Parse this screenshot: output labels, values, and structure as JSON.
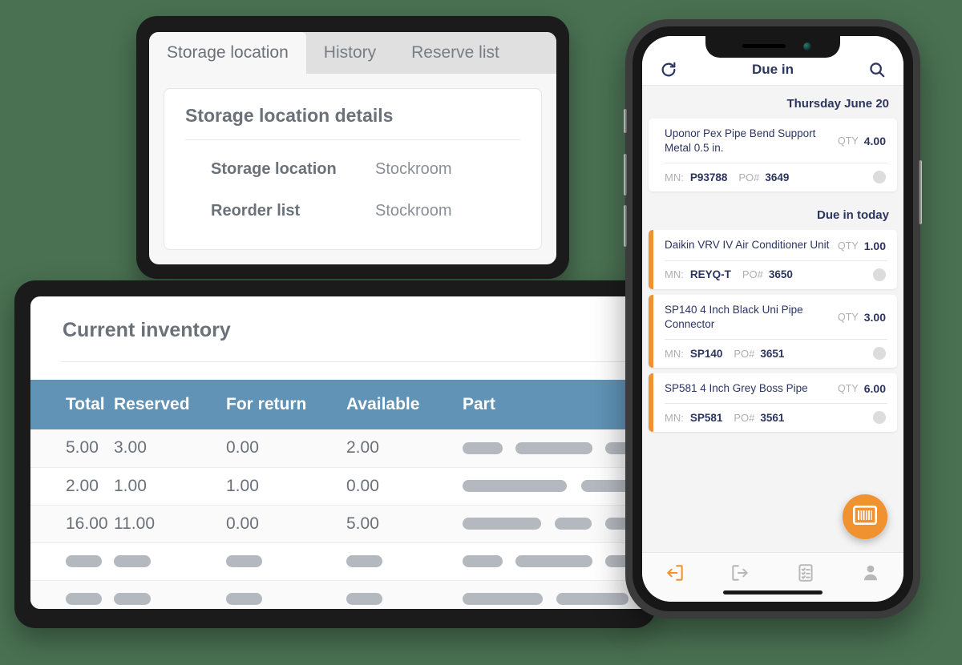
{
  "storage_card": {
    "tabs": [
      {
        "label": "Storage location",
        "active": true
      },
      {
        "label": "History",
        "active": false
      },
      {
        "label": "Reserve list",
        "active": false
      }
    ],
    "panel_title": "Storage location details",
    "fields": [
      {
        "label": "Storage location",
        "value": "Stockroom"
      },
      {
        "label": "Reorder list",
        "value": "Stockroom"
      }
    ]
  },
  "inventory_card": {
    "title": "Current inventory",
    "header_color": "#6093b5",
    "columns": [
      "Total",
      "Reserved",
      "For return",
      "Available",
      "Part"
    ],
    "rows": [
      {
        "total": "5.00",
        "reserved": "3.00",
        "for_return": "0.00",
        "available": "2.00",
        "part_placeholder": true
      },
      {
        "total": "2.00",
        "reserved": "1.00",
        "for_return": "1.00",
        "available": "0.00",
        "part_placeholder": true
      },
      {
        "total": "16.00",
        "reserved": "11.00",
        "for_return": "0.00",
        "available": "5.00",
        "part_placeholder": true
      },
      {
        "total": "",
        "reserved": "",
        "for_return": "",
        "available": "",
        "part_placeholder": true
      },
      {
        "total": "",
        "reserved": "",
        "for_return": "",
        "available": "",
        "part_placeholder": true
      }
    ]
  },
  "phone": {
    "accent_color": "#f0922f",
    "text_color": "#2c3560",
    "header": {
      "title": "Due in",
      "refresh_icon": "refresh-icon",
      "search_icon": "search-icon"
    },
    "sections": [
      {
        "heading": "Thursday June 20",
        "items": [
          {
            "name": "Uponor Pex Pipe Bend Support Metal 0.5 in.",
            "qty_label": "QTY",
            "qty": "4.00",
            "mn_label": "MN:",
            "mn": "P93788",
            "po_label": "PO#",
            "po": "3649",
            "accent_bar": false
          }
        ]
      },
      {
        "heading": "Due in today",
        "items": [
          {
            "name": "Daikin VRV IV Air Conditioner Unit",
            "qty_label": "QTY",
            "qty": "1.00",
            "mn_label": "MN:",
            "mn": "REYQ-T",
            "po_label": "PO#",
            "po": "3650",
            "accent_bar": true
          },
          {
            "name": "SP140 4 Inch Black Uni Pipe Connector",
            "qty_label": "QTY",
            "qty": "3.00",
            "mn_label": "MN:",
            "mn": "SP140",
            "po_label": "PO#",
            "po": "3651",
            "accent_bar": true
          },
          {
            "name": "SP581 4 Inch Grey Boss Pipe",
            "qty_label": "QTY",
            "qty": "6.00",
            "mn_label": "MN:",
            "mn": "SP581",
            "po_label": "PO#",
            "po": "3561",
            "accent_bar": true
          }
        ]
      }
    ],
    "fab": {
      "icon": "barcode-icon"
    },
    "bottom_nav": [
      {
        "icon": "arrow-into-box-icon",
        "active": true
      },
      {
        "icon": "arrow-out-of-box-icon",
        "active": false
      },
      {
        "icon": "checklist-document-icon",
        "active": false
      },
      {
        "icon": "person-icon",
        "active": false
      }
    ]
  }
}
